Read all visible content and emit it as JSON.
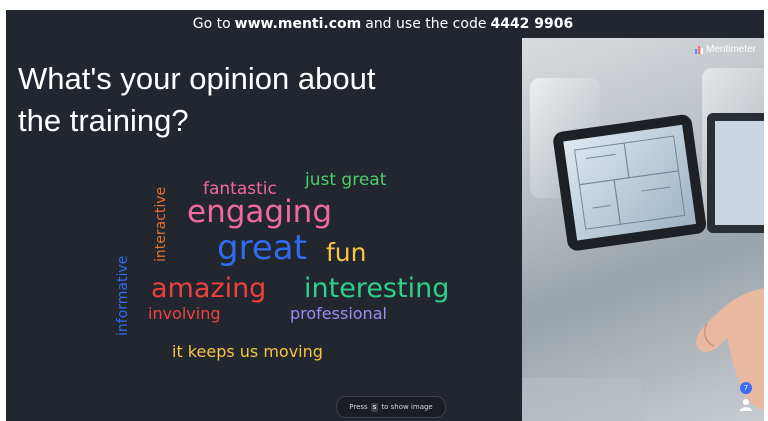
{
  "topbar": {
    "prefix": "Go to",
    "url": "www.menti.com",
    "middle": "and use the code",
    "code": "4442 9906"
  },
  "question": {
    "line1": "What's your opinion about",
    "line2": "the training?"
  },
  "brand": {
    "name": "Mentimeter"
  },
  "wordcloud": [
    {
      "text": "just great",
      "color": "#4ccf66"
    },
    {
      "text": "fantastic",
      "color": "#f06a9a"
    },
    {
      "text": "engaging",
      "color": "#f06a9a"
    },
    {
      "text": "interactive",
      "color": "#e0742a"
    },
    {
      "text": "great",
      "color": "#2f6cf0"
    },
    {
      "text": "fun",
      "color": "#f5c542"
    },
    {
      "text": "informative",
      "color": "#2f6cf0"
    },
    {
      "text": "amazing",
      "color": "#ef4040"
    },
    {
      "text": "interesting",
      "color": "#2fd08a"
    },
    {
      "text": "involving",
      "color": "#ef4040"
    },
    {
      "text": "professional",
      "color": "#9b8cf2"
    },
    {
      "text": "it keeps us moving",
      "color": "#f5c542"
    }
  ],
  "hint": {
    "before": "Press",
    "key": "s",
    "after": "to show image"
  },
  "participants": {
    "count": "7"
  },
  "icons": {
    "logo": "mentimeter-bars-icon",
    "person": "person-icon"
  }
}
